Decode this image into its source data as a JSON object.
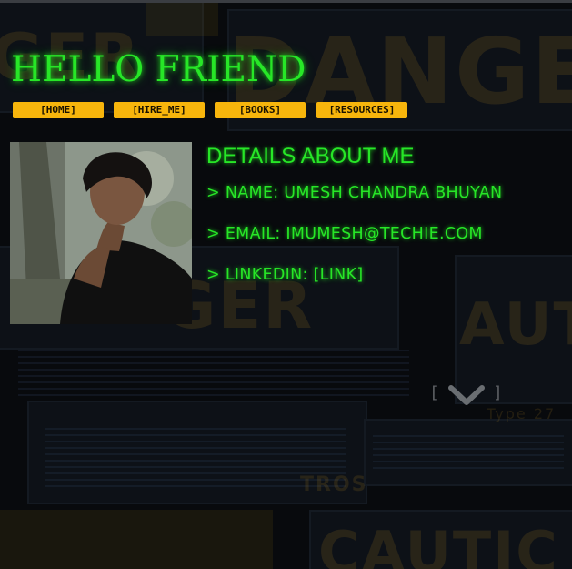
{
  "header": {
    "title": "HELLO FRIEND"
  },
  "nav": {
    "items": [
      {
        "label": "[HOME]"
      },
      {
        "label": "[HIRE_ME]"
      },
      {
        "label": "[BOOKS]"
      },
      {
        "label": "[RESOURCES]"
      }
    ]
  },
  "profile": {
    "photo_icon": "profile-photo",
    "section_title": "DETAILS ABOUT ME",
    "name_line": "> NAME: UMESH CHANDRA BHUYAN",
    "email_line": "> EMAIL: IMUMESH@TECHIE.COM",
    "linkedin_line": "> LINKEDIN: [LINK]"
  },
  "scroll_hint": {
    "left_bracket": "[",
    "right_bracket": "]",
    "icon": "chevron-down-icon"
  },
  "colors": {
    "accent_green": "#27e627",
    "button_yellow": "#f7b50c",
    "background": "#07090c"
  }
}
